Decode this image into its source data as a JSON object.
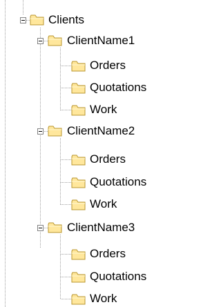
{
  "tree": {
    "root": {
      "label": "Clients",
      "expanded": true,
      "children": [
        {
          "label": "ClientName1",
          "expanded": true,
          "children": [
            {
              "label": "Orders"
            },
            {
              "label": "Quotations"
            },
            {
              "label": "Work"
            }
          ]
        },
        {
          "label": "ClientName2",
          "expanded": true,
          "children": [
            {
              "label": "Orders"
            },
            {
              "label": "Quotations"
            },
            {
              "label": "Work"
            }
          ]
        },
        {
          "label": "ClientName3",
          "expanded": true,
          "children": [
            {
              "label": "Orders"
            },
            {
              "label": "Quotations"
            },
            {
              "label": "Work"
            }
          ]
        }
      ]
    },
    "colors": {
      "folder_fill": "#FFE79C",
      "folder_edge": "#B8962E",
      "dotted_line": "#A0A0A0"
    }
  }
}
